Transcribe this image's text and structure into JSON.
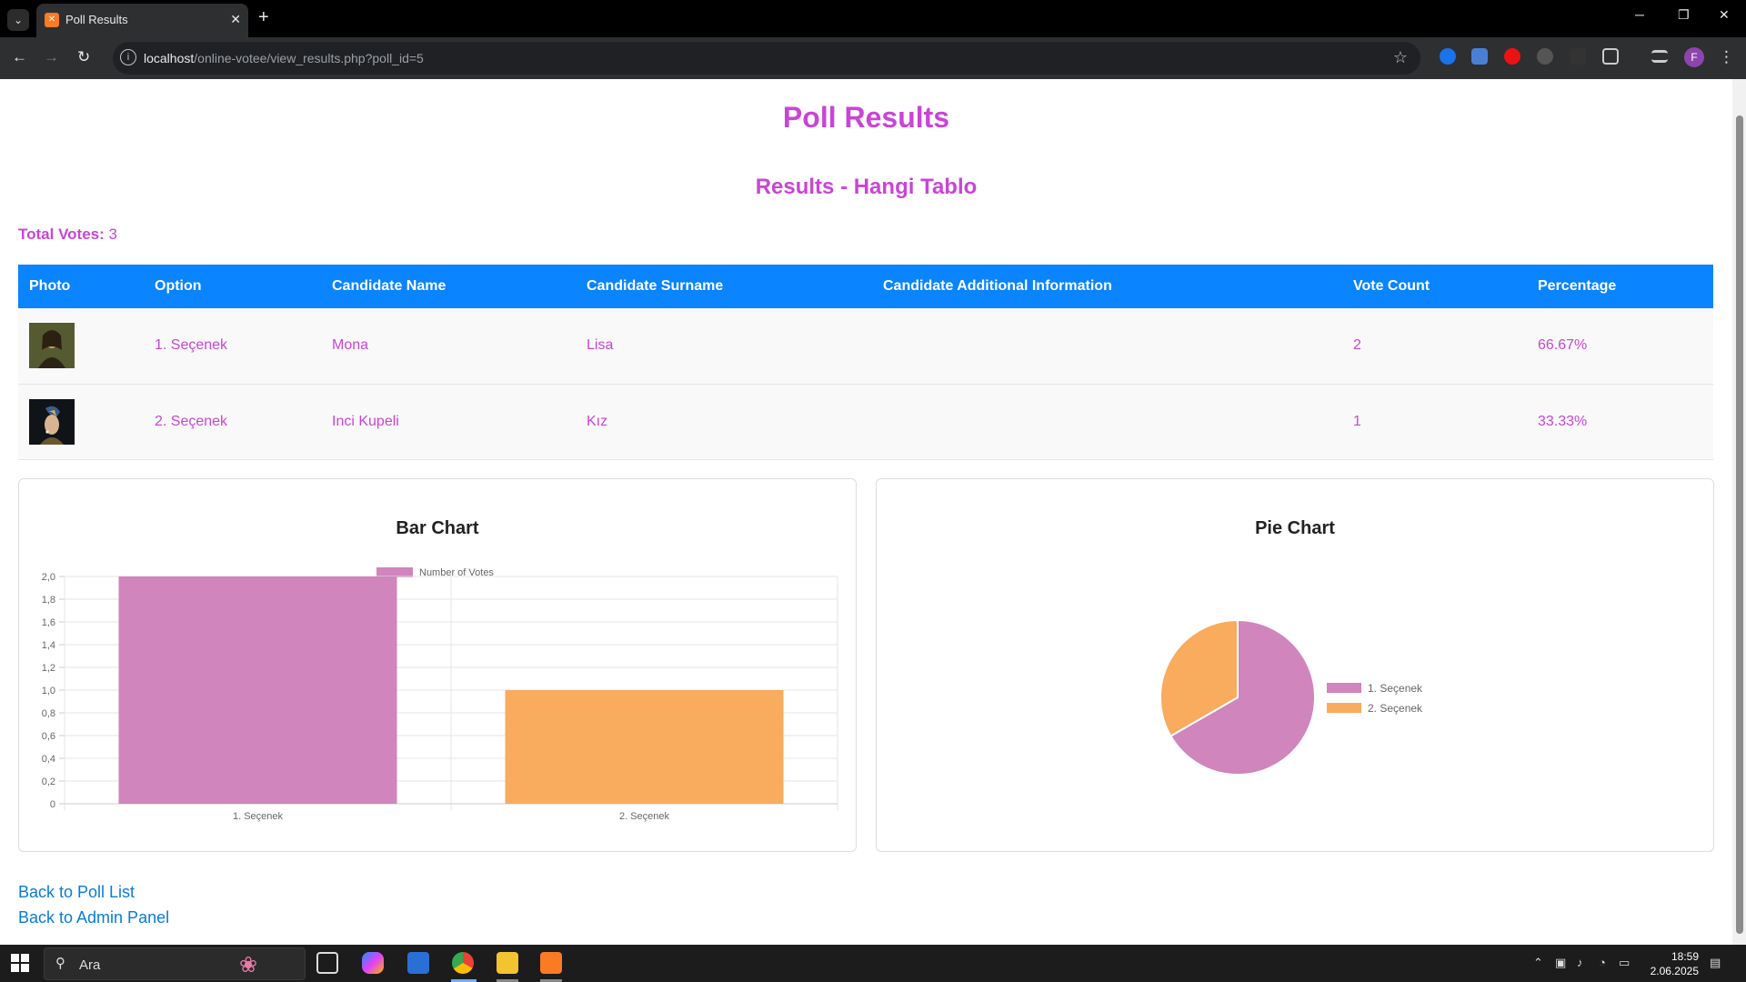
{
  "browser": {
    "tab_title": "Poll Results",
    "url_host": "localhost",
    "url_path": "/online-votee/view_results.php?poll_id=5"
  },
  "page": {
    "title": "Poll Results",
    "subtitle": "Results - Hangi Tablo",
    "total_label": "Total Votes:",
    "total_value": "3"
  },
  "table": {
    "headers": [
      "Photo",
      "Option",
      "Candidate Name",
      "Candidate Surname",
      "Candidate Additional Information",
      "Vote Count",
      "Percentage"
    ],
    "rows": [
      {
        "option": "1. Seçenek",
        "name": "Mona",
        "surname": "Lisa",
        "info": "",
        "votes": "2",
        "percentage": "66.67%"
      },
      {
        "option": "2. Seçenek",
        "name": "Inci Kupeli",
        "surname": "Kız",
        "info": "",
        "votes": "1",
        "percentage": "33.33%"
      }
    ]
  },
  "bar_card_title": "Bar Chart",
  "pie_card_title": "Pie Chart",
  "chart_data": [
    {
      "type": "bar",
      "categories": [
        "1. Seçenek",
        "2. Seçenek"
      ],
      "series": [
        {
          "name": "Number of Votes",
          "values": [
            2,
            1
          ]
        }
      ],
      "colors": [
        "#d085bc",
        "#f9ab5e"
      ],
      "ylim": [
        0,
        2
      ],
      "yticks": [
        "0",
        "0,2",
        "0,4",
        "0,6",
        "0,8",
        "1,0",
        "1,2",
        "1,4",
        "1,6",
        "1,8",
        "2,0"
      ],
      "grid": true,
      "legend": "top"
    },
    {
      "type": "pie",
      "labels": [
        "1. Seçenek",
        "2. Seçenek"
      ],
      "values": [
        2,
        1
      ],
      "colors": [
        "#d085bc",
        "#f9ab5e"
      ],
      "legend": "right"
    }
  ],
  "links": {
    "back_poll_list": "Back to Poll List",
    "back_admin": "Back to Admin Panel"
  },
  "taskbar": {
    "search_text": "Ara",
    "time": "18:59",
    "date": "2.06.2025"
  },
  "colors": {
    "accent": "#c945d6",
    "table_header": "#0a84ff",
    "link": "#0a7bd6"
  }
}
